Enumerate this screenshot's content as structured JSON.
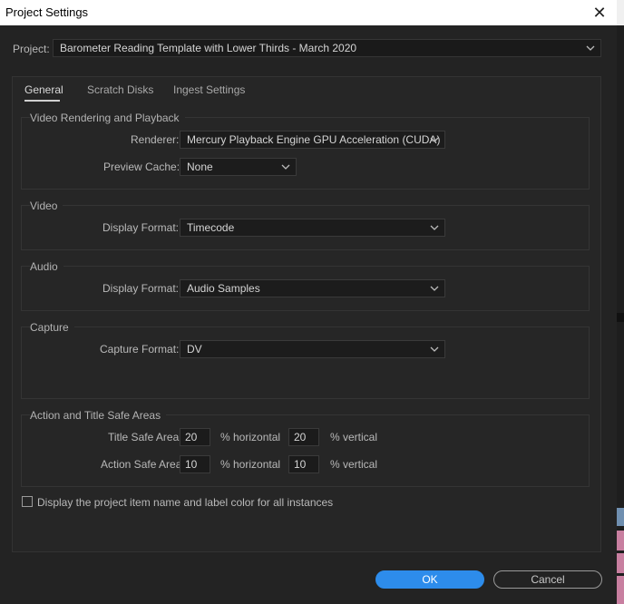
{
  "window": {
    "title": "Project Settings",
    "close_glyph": "✕"
  },
  "project": {
    "label": "Project:",
    "value": "Barometer Reading Template with Lower Thirds - March 2020"
  },
  "tabs": [
    {
      "label": "General",
      "active": true
    },
    {
      "label": "Scratch Disks",
      "active": false
    },
    {
      "label": "Ingest Settings",
      "active": false
    }
  ],
  "video_rendering": {
    "title": "Video Rendering and Playback",
    "renderer_label": "Renderer:",
    "renderer_value": "Mercury Playback Engine GPU Acceleration (CUDA)",
    "preview_cache_label": "Preview Cache:",
    "preview_cache_value": "None"
  },
  "video": {
    "title": "Video",
    "display_format_label": "Display Format:",
    "display_format_value": "Timecode"
  },
  "audio": {
    "title": "Audio",
    "display_format_label": "Display Format:",
    "display_format_value": "Audio Samples"
  },
  "capture": {
    "title": "Capture",
    "capture_format_label": "Capture Format:",
    "capture_format_value": "DV"
  },
  "safe_areas": {
    "title": "Action and Title Safe Areas",
    "title_safe_label": "Title Safe Area",
    "title_safe_horizontal": "20",
    "title_safe_vertical": "20",
    "action_safe_label": "Action Safe Area",
    "action_safe_horizontal": "10",
    "action_safe_vertical": "10",
    "horizontal_unit": "% horizontal",
    "vertical_unit": "% vertical"
  },
  "display_item_name": {
    "label": "Display the project item name and label color for all instances",
    "checked": false
  },
  "buttons": {
    "ok": "OK",
    "cancel": "Cancel"
  },
  "colors": {
    "accent": "#2d8ceb",
    "background": "#232323"
  }
}
